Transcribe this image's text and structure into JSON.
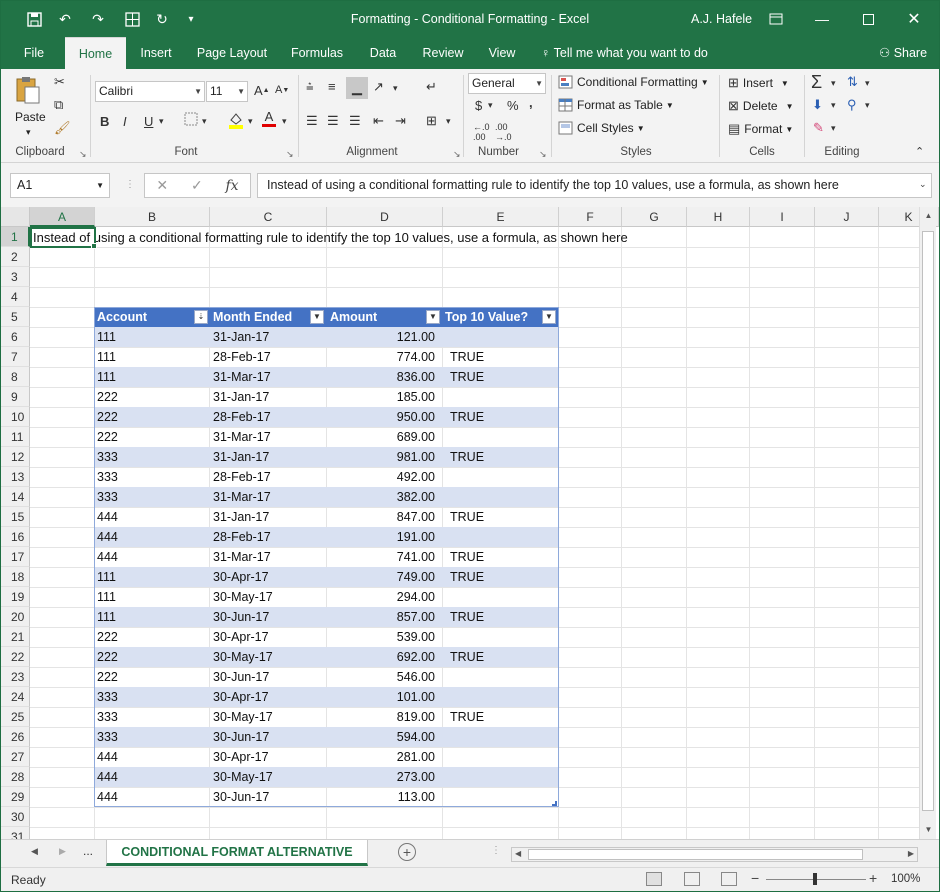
{
  "titlebar": {
    "title": "Formatting - Conditional Formatting  -  Excel",
    "user": "A.J. Hafele"
  },
  "tabs": [
    "File",
    "Home",
    "Insert",
    "Page Layout",
    "Formulas",
    "Data",
    "Review",
    "View"
  ],
  "tellme": "Tell me what you want to do",
  "share": "Share",
  "ribbon": {
    "clipboard": {
      "label": "Clipboard",
      "paste": "Paste"
    },
    "font": {
      "label": "Font",
      "name": "Calibri",
      "size": "11"
    },
    "alignment": {
      "label": "Alignment"
    },
    "number": {
      "label": "Number",
      "format": "General"
    },
    "styles": {
      "label": "Styles",
      "conditional": "Conditional Formatting",
      "format_table": "Format as Table",
      "cell_styles": "Cell Styles"
    },
    "cells": {
      "label": "Cells",
      "insert": "Insert",
      "delete": "Delete",
      "format": "Format"
    },
    "editing": {
      "label": "Editing"
    }
  },
  "formula_bar": {
    "name_box": "A1",
    "formula": "Instead of using a conditional formatting rule to identify the top 10 values, use a formula, as shown here"
  },
  "columns": [
    "A",
    "B",
    "C",
    "D",
    "E",
    "F",
    "G",
    "H",
    "I",
    "J",
    "K"
  ],
  "rows": [
    "1",
    "2",
    "3",
    "4",
    "5",
    "6",
    "7",
    "8",
    "9",
    "10",
    "11",
    "12",
    "13",
    "14",
    "15",
    "16",
    "17",
    "18",
    "19",
    "20",
    "21",
    "22",
    "23",
    "24",
    "25",
    "26",
    "27",
    "28",
    "29",
    "30",
    "31"
  ],
  "cell_a1": "Instead of using a conditional formatting rule to identify the top 10 values, use a formula, as shown here",
  "table": {
    "headers": [
      "Account",
      "Month Ended",
      "Amount",
      "Top 10 Value?"
    ],
    "rows": [
      [
        "111",
        "31-Jan-17",
        "121.00",
        ""
      ],
      [
        "111",
        "28-Feb-17",
        "774.00",
        "TRUE"
      ],
      [
        "111",
        "31-Mar-17",
        "836.00",
        "TRUE"
      ],
      [
        "222",
        "31-Jan-17",
        "185.00",
        ""
      ],
      [
        "222",
        "28-Feb-17",
        "950.00",
        "TRUE"
      ],
      [
        "222",
        "31-Mar-17",
        "689.00",
        ""
      ],
      [
        "333",
        "31-Jan-17",
        "981.00",
        "TRUE"
      ],
      [
        "333",
        "28-Feb-17",
        "492.00",
        ""
      ],
      [
        "333",
        "31-Mar-17",
        "382.00",
        ""
      ],
      [
        "444",
        "31-Jan-17",
        "847.00",
        "TRUE"
      ],
      [
        "444",
        "28-Feb-17",
        "191.00",
        ""
      ],
      [
        "444",
        "31-Mar-17",
        "741.00",
        "TRUE"
      ],
      [
        "111",
        "30-Apr-17",
        "749.00",
        "TRUE"
      ],
      [
        "111",
        "30-May-17",
        "294.00",
        ""
      ],
      [
        "111",
        "30-Jun-17",
        "857.00",
        "TRUE"
      ],
      [
        "222",
        "30-Apr-17",
        "539.00",
        ""
      ],
      [
        "222",
        "30-May-17",
        "692.00",
        "TRUE"
      ],
      [
        "222",
        "30-Jun-17",
        "546.00",
        ""
      ],
      [
        "333",
        "30-Apr-17",
        "101.00",
        ""
      ],
      [
        "333",
        "30-May-17",
        "819.00",
        "TRUE"
      ],
      [
        "333",
        "30-Jun-17",
        "594.00",
        ""
      ],
      [
        "444",
        "30-Apr-17",
        "281.00",
        ""
      ],
      [
        "444",
        "30-May-17",
        "273.00",
        ""
      ],
      [
        "444",
        "30-Jun-17",
        "113.00",
        ""
      ]
    ]
  },
  "sheet_tab": "CONDITIONAL FORMAT ALTERNATIVE",
  "sheet_more": "...",
  "status": {
    "ready": "Ready",
    "zoom": "100%"
  },
  "colors": {
    "accent": "#217346",
    "table_header": "#4472c4",
    "band": "#d9e1f2"
  }
}
